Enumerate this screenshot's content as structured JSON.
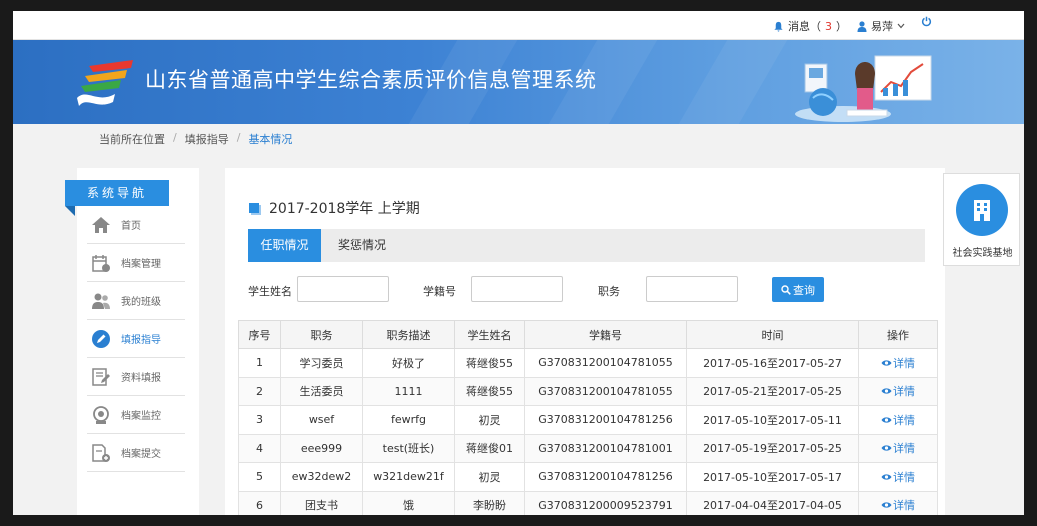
{
  "topbar": {
    "messages_label": "消息（",
    "messages_count": "3",
    "messages_close": "）",
    "user_name": "易萍"
  },
  "banner": {
    "title": "山东省普通高中学生综合素质评价信息管理系统"
  },
  "breadcrumb": {
    "items": [
      "当前所在位置",
      "填报指导",
      "基本情况"
    ]
  },
  "sidebar": {
    "title": "系统导航",
    "items": [
      {
        "label": "首页",
        "icon": "home-icon"
      },
      {
        "label": "档案管理",
        "icon": "archive-calendar-icon"
      },
      {
        "label": "我的班级",
        "icon": "users-icon"
      },
      {
        "label": "填报指导",
        "icon": "pen-circle-icon"
      },
      {
        "label": "资料填报",
        "icon": "edit-form-icon"
      },
      {
        "label": "档案监控",
        "icon": "monitor-icon"
      },
      {
        "label": "档案提交",
        "icon": "submit-doc-icon"
      }
    ],
    "active_index": 3
  },
  "main": {
    "term": "2017-2018学年 上学期",
    "tabs": [
      "任职情况",
      "奖惩情况"
    ],
    "filters": {
      "student_name_label": "学生姓名",
      "student_id_label": "学籍号",
      "position_label": "职务",
      "query_button": "查询"
    },
    "table": {
      "headers": [
        "序号",
        "职务",
        "职务描述",
        "学生姓名",
        "学籍号",
        "时间",
        "操作"
      ],
      "rows": [
        [
          "1",
          "学习委员",
          "好极了",
          "蒋继俊55",
          "G370831200104781055",
          "2017-05-16至2017-05-27",
          "详情"
        ],
        [
          "2",
          "生活委员",
          "1111",
          "蒋继俊55",
          "G370831200104781055",
          "2017-05-21至2017-05-25",
          "详情"
        ],
        [
          "3",
          "wsef",
          "fewrfg",
          "初灵",
          "G370831200104781256",
          "2017-05-10至2017-05-11",
          "详情"
        ],
        [
          "4",
          "eee999",
          "test(班长)",
          "蒋继俊01",
          "G370831200104781001",
          "2017-05-19至2017-05-25",
          "详情"
        ],
        [
          "5",
          "ew32dew2",
          "w321dew21f",
          "初灵",
          "G370831200104781256",
          "2017-05-10至2017-05-17",
          "详情"
        ],
        [
          "6",
          "团支书",
          "饿",
          "李盼盼",
          "G370831200009523791",
          "2017-04-04至2017-04-05",
          "详情"
        ]
      ]
    }
  },
  "right_widget": {
    "label": "社会实践基地",
    "icon": "building-icon"
  },
  "colors": {
    "primary": "#2a8ee0",
    "banner": "#3d82d4",
    "badge": "#e1352d"
  }
}
